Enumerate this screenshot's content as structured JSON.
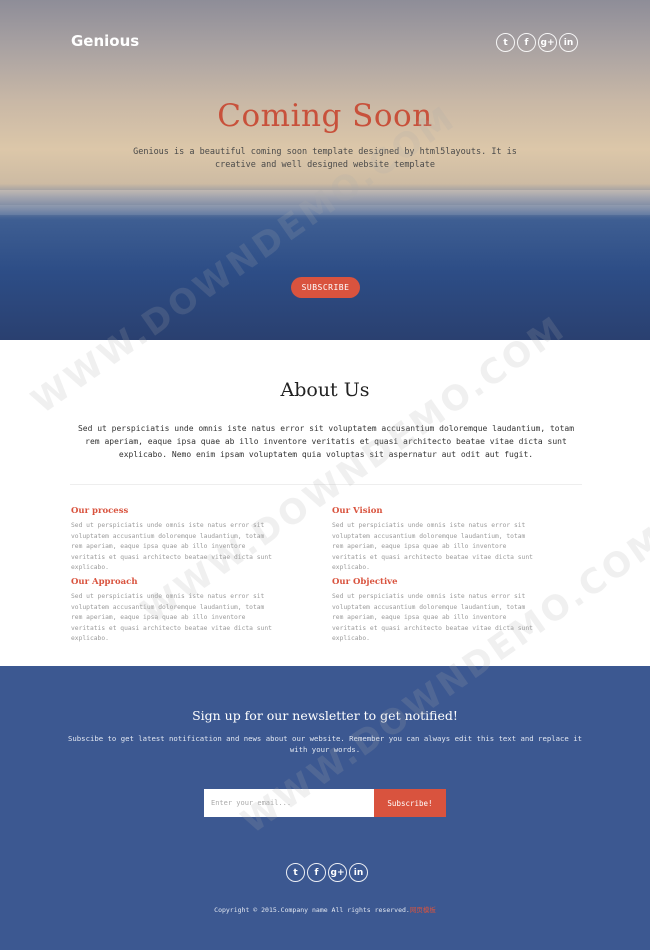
{
  "header": {
    "logo": "Genious",
    "social": [
      {
        "icon": "twitter-icon",
        "glyph": "t"
      },
      {
        "icon": "facebook-icon",
        "glyph": "f"
      },
      {
        "icon": "google-plus-icon",
        "glyph": "g+"
      },
      {
        "icon": "linkedin-icon",
        "glyph": "in"
      }
    ]
  },
  "hero": {
    "title": "Coming Soon",
    "text": "Genious is a beautiful coming soon template designed by html5layouts. It is creative and well designed website template",
    "subscribe_label": "SUBSCRIBE"
  },
  "about": {
    "title": "About Us",
    "text": "Sed ut perspiciatis unde omnis iste natus error sit voluptatem accusantium doloremque laudantium, totam rem aperiam, eaque ipsa quae ab illo inventore veritatis et quasi architecto beatae vitae dicta sunt explicabo. Nemo enim ipsam voluptatem quia voluptas sit aspernatur aut odit aut fugit.",
    "features": [
      {
        "title": "Our process",
        "text": "Sed ut perspiciatis unde omnis iste natus error sit voluptatem accusantium doloremque laudantium, totam rem aperiam, eaque ipsa quae ab illo inventore veritatis et quasi architecto beatae vitae dicta sunt explicabo."
      },
      {
        "title": "Our Vision",
        "text": "Sed ut perspiciatis unde omnis iste natus error sit voluptatem accusantium doloremque laudantium, totam rem aperiam, eaque ipsa quae ab illo inventore veritatis et quasi architecto beatae vitae dicta sunt explicabo."
      },
      {
        "title": "Our Approach",
        "text": "Sed ut perspiciatis unde omnis iste natus error sit voluptatem accusantium doloremque laudantium, totam rem aperiam, eaque ipsa quae ab illo inventore veritatis et quasi architecto beatae vitae dicta sunt explicabo."
      },
      {
        "title": "Our Objective",
        "text": "Sed ut perspiciatis unde omnis iste natus error sit voluptatem accusantium doloremque laudantium, totam rem aperiam, eaque ipsa quae ab illo inventore veritatis et quasi architecto beatae vitae dicta sunt explicabo."
      }
    ]
  },
  "newsletter": {
    "title": "Sign up for our newsletter to get notified!",
    "text": "Subscibe to get latest notification and news about our website. Remember you can always edit this text and replace it with your words.",
    "email_placeholder": "Enter your email...",
    "button_label": "Subscribe!"
  },
  "footer": {
    "copyright": "Copyright © 2015.Company name All rights reserved.",
    "link": "网页模板"
  },
  "watermark": "WWW.DOWNDEMO.COM",
  "colors": {
    "accent": "#d9533e",
    "newsletter_bg": "#3c5891"
  }
}
